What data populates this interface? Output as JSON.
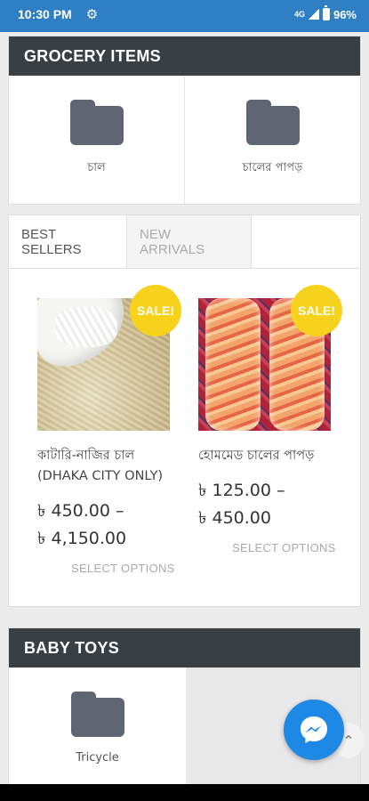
{
  "status_bar": {
    "time": "10:30 PM",
    "network": "4G",
    "battery": "96%"
  },
  "grocery": {
    "title": "GROCERY ITEMS",
    "categories": [
      {
        "label": "চাল",
        "icon": "folder-icon"
      },
      {
        "label": "চালের পাপড়",
        "icon": "folder-icon"
      }
    ]
  },
  "tabs": {
    "items": [
      {
        "label": "BEST SELLERS",
        "active": true
      },
      {
        "label": "NEW ARRIVALS",
        "active": false
      }
    ]
  },
  "products": [
    {
      "name": "কাটারি-নাজির চাল (DHAKA CITY ONLY)",
      "price_line1": "৳ 450.00 –",
      "price_line2": "৳ 4,150.00",
      "badge": "SALE!",
      "action": "SELECT OPTIONS"
    },
    {
      "name": "হোমমেড চালের পাপড়",
      "price_line1": "৳ 125.00 –",
      "price_line2": "৳ 450.00",
      "badge": "SALE!",
      "action": "SELECT OPTIONS"
    }
  ],
  "baby_toys": {
    "title": "BABY TOYS",
    "categories": [
      {
        "label": "Tricycle",
        "icon": "folder-icon"
      }
    ]
  },
  "colors": {
    "status_bar": "#2f7fc4",
    "section_header": "#3a3f44",
    "folder": "#5d6672",
    "sale_badge": "#f7d21c",
    "messenger": "#1e88e5"
  }
}
